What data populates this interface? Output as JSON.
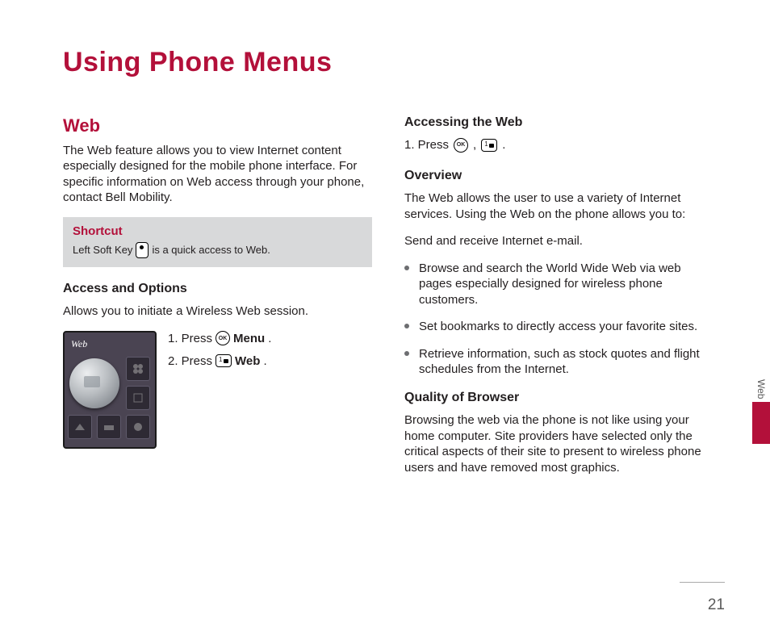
{
  "chapter_title": "Using Phone Menus",
  "left": {
    "section_title": "Web",
    "intro": "The Web feature allows you to view Internet content especially designed for the mobile phone interface. For specific information on Web access through your phone, contact Bell Mobility.",
    "shortcut": {
      "title": "Shortcut",
      "before": "Left Soft Key",
      "after": "is a quick access to Web."
    },
    "access_heading": "Access and Options",
    "access_intro": "Allows you to initiate a Wireless Web session.",
    "phone_caption": "Web",
    "steps": {
      "s1_num": "1. Press",
      "s1_bold": "Menu",
      "s2_num": "2. Press",
      "s2_bold": "Web"
    }
  },
  "right": {
    "accessing_heading": "Accessing the Web",
    "press_num": "1.  Press",
    "overview_heading": "Overview",
    "overview_p": "The Web allows the user to use a variety of Internet services. Using the Web on the phone allows you to:",
    "overview_line": "Send and receive Internet e-mail.",
    "bullets": [
      "Browse and search the World Wide Web via web pages especially designed for wireless phone customers.",
      "Set bookmarks to directly access your favorite sites.",
      "Retrieve information, such as stock quotes and flight schedules from the Internet."
    ],
    "quality_heading": "Quality of Browser",
    "quality_p": "Browsing the web via the phone is not like using your home computer. Site providers have selected only the critical aspects of their site to present to wireless phone users and have removed most graphics."
  },
  "side_label": "Web",
  "page_number": "21"
}
